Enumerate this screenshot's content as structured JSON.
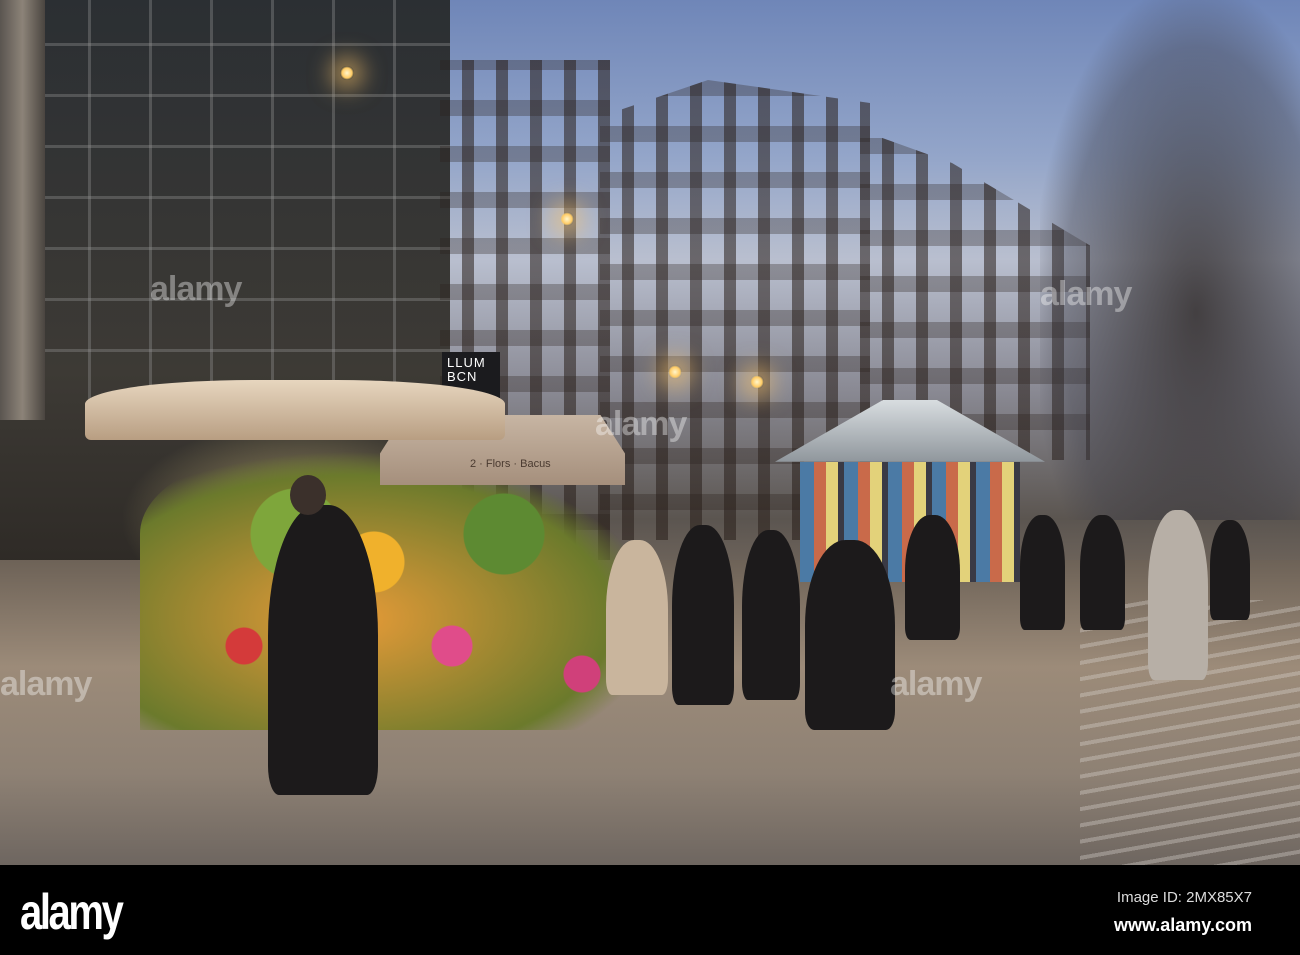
{
  "photo": {
    "description_alt": "Evening street scene with flower stall",
    "sign_text": [
      "LLUM",
      "BCN"
    ],
    "awning_text": "2 · Flors · Bacus",
    "watermark": "alamy"
  },
  "footer": {
    "logo": "alamy",
    "image_id": "Image ID: 2MX85X7",
    "url": "www.alamy.com"
  }
}
